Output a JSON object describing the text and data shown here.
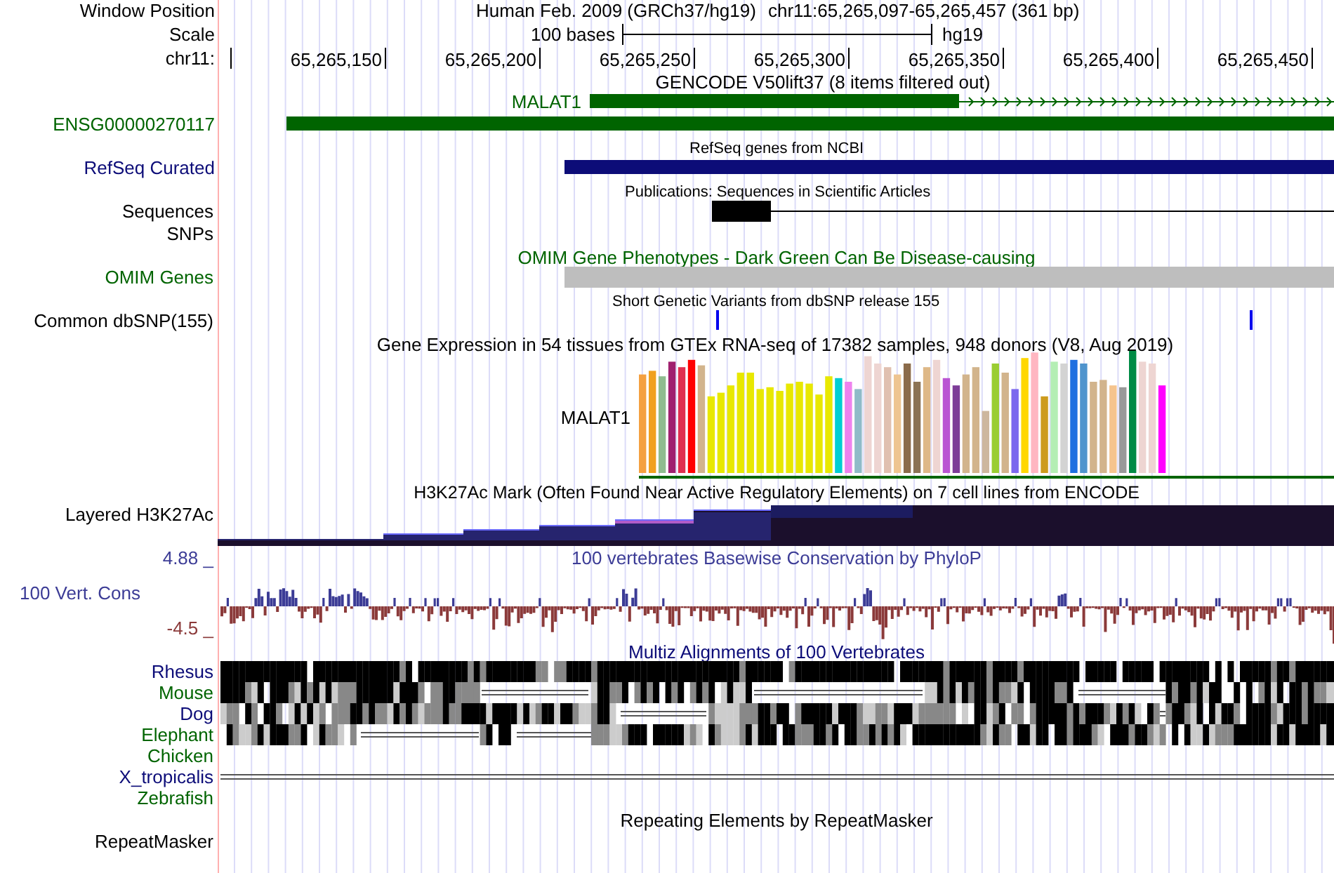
{
  "header": {
    "labels": [
      "Window Position",
      "Scale",
      "chr11:"
    ],
    "assembly_title": "Human Feb. 2009 (GRCh37/hg19)",
    "position": "chr11:65,265,097-65,265,457 (361 bp)",
    "scale_length": "100 bases",
    "scale_assembly": "hg19"
  },
  "ruler": {
    "ticks": [
      "65,265,150",
      "65,265,200",
      "65,265,250",
      "65,265,300",
      "65,265,350",
      "65,265,400",
      "65,265,450"
    ]
  },
  "tracks": [
    {
      "kind": "gencode",
      "title": "GENCODE V50lift37 (8 items filtered out)",
      "genes": [
        "MALAT1",
        "ENSG00000270117"
      ],
      "color": "#006400"
    },
    {
      "kind": "refseq",
      "title": "RefSeq genes from NCBI",
      "label": "RefSeq Curated",
      "color": "#0c0c78"
    },
    {
      "kind": "publications",
      "title": "Publications: Sequences in Scientific Articles",
      "label_lines": [
        "Sequences",
        "SNPs"
      ]
    },
    {
      "kind": "omim",
      "title": "OMIM Gene Phenotypes - Dark Green Can Be Disease-causing",
      "label": "OMIM Genes",
      "color": "#006400"
    },
    {
      "kind": "snp",
      "title": "Short Genetic Variants from dbSNP release 155",
      "label": "Common dbSNP(155)"
    },
    {
      "kind": "gtex",
      "title": "Gene Expression in 54 tissues from GTEx RNA-seq of 17382 samples, 948 donors (V8, Aug 2019)",
      "gene": "MALAT1"
    },
    {
      "kind": "h3k27ac",
      "title": "H3K27Ac Mark (Often Found Near Active Regulatory Elements) on 7 cell lines from ENCODE",
      "label": "Layered H3K27Ac"
    },
    {
      "kind": "phylop",
      "title": "100 vertebrates Basewise Conservation by PhyloP",
      "label": "100 Vert. Cons",
      "y_max": "4.88 _",
      "y_min": "-4.5 _"
    },
    {
      "kind": "multiz",
      "title": "Multiz Alignments of 100 Vertebrates",
      "species": [
        {
          "name": "Rhesus",
          "color": "#0c0c78",
          "kind": "aligned"
        },
        {
          "name": "Mouse",
          "color": "#006400",
          "kind": "aligned"
        },
        {
          "name": "Dog",
          "color": "#0c0c78",
          "kind": "aligned"
        },
        {
          "name": "Elephant",
          "color": "#006400",
          "kind": "aligned"
        },
        {
          "name": "Chicken",
          "color": "#006400",
          "kind": "missing"
        },
        {
          "name": "X_tropicalis",
          "color": "#0c0c78",
          "kind": "unaligned"
        },
        {
          "name": "Zebrafish",
          "color": "#006400",
          "kind": "missing"
        }
      ]
    },
    {
      "kind": "repeatmasker",
      "title": "Repeating Elements by RepeatMasker",
      "label": "RepeatMasker"
    }
  ]
}
